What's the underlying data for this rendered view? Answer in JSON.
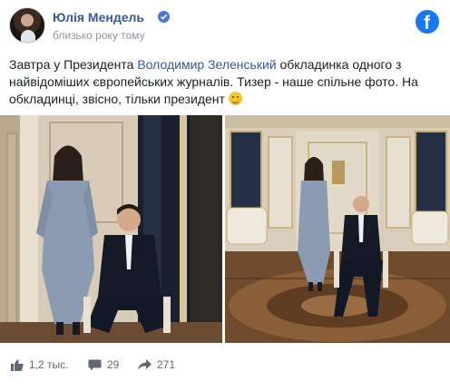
{
  "post": {
    "author": "Юлія Мендель",
    "timestamp": "близько року тому",
    "text_before": "Завтра у Президента ",
    "mention": "Володимир Зеленський",
    "text_after": " обкладинка одного з найвідоміших європейських журналів. Тизер - наше спільне фото. На обкладинці, звісно, тільки президент",
    "emoji": "smiling-face-emoji"
  },
  "icons": {
    "verified": "verified-badge-icon",
    "brand": "facebook-logo-icon",
    "like": "thumbs-up-icon",
    "comment": "comment-icon",
    "share": "share-arrow-icon"
  },
  "photos": [
    {
      "name": "photo-left",
      "description_shown": false
    },
    {
      "name": "photo-right",
      "description_shown": false
    }
  ],
  "stats": {
    "likes": "1,2 тыс.",
    "comments": "29",
    "shares": "271"
  },
  "colors": {
    "link": "#385898",
    "brand": "#1877f2",
    "muted": "#90949c"
  }
}
